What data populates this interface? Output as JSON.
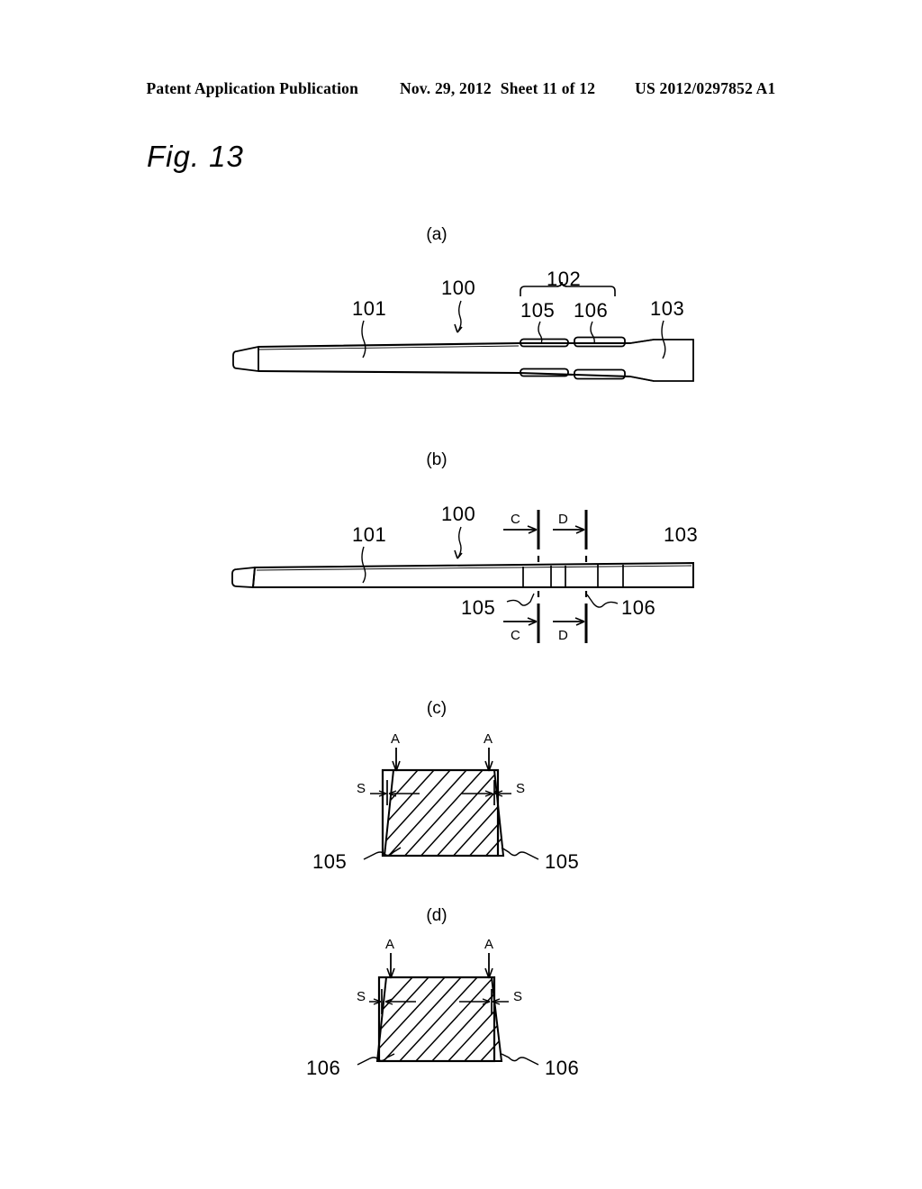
{
  "header": {
    "publication": "Patent Application Publication",
    "date": "Nov. 29, 2012",
    "sheet": "Sheet 11 of 12",
    "number": "US 2012/0297852 A1"
  },
  "figure": {
    "title": "Fig. 13",
    "panels": [
      {
        "id": "a",
        "label": "(a)"
      },
      {
        "id": "b",
        "label": "(b)"
      },
      {
        "id": "c",
        "label": "(c)"
      },
      {
        "id": "d",
        "label": "(d)"
      }
    ]
  },
  "panel_a": {
    "label": "(a)",
    "refs": {
      "shaft": "101",
      "device": "100",
      "marker_group": "102",
      "marker_first": "105",
      "marker_second": "106",
      "proximal": "103"
    }
  },
  "panel_b": {
    "label": "(b)",
    "refs": {
      "shaft": "101",
      "device": "100",
      "marker_first": "105",
      "marker_second": "106",
      "proximal": "103"
    },
    "section_lines": {
      "top_left": "C",
      "top_right": "D",
      "bottom_left": "C",
      "bottom_right": "D"
    }
  },
  "panel_c": {
    "label": "(c)",
    "arrows": {
      "left": "A",
      "right": "A"
    },
    "dimensions": {
      "left": "S",
      "right": "S"
    },
    "refs": {
      "left": "105",
      "right": "105"
    }
  },
  "panel_d": {
    "label": "(d)",
    "arrows": {
      "left": "A",
      "right": "A"
    },
    "dimensions": {
      "left": "S",
      "right": "S"
    },
    "refs": {
      "left": "106",
      "right": "106"
    }
  },
  "style": {
    "ink": "#000000",
    "paper": "#ffffff"
  }
}
